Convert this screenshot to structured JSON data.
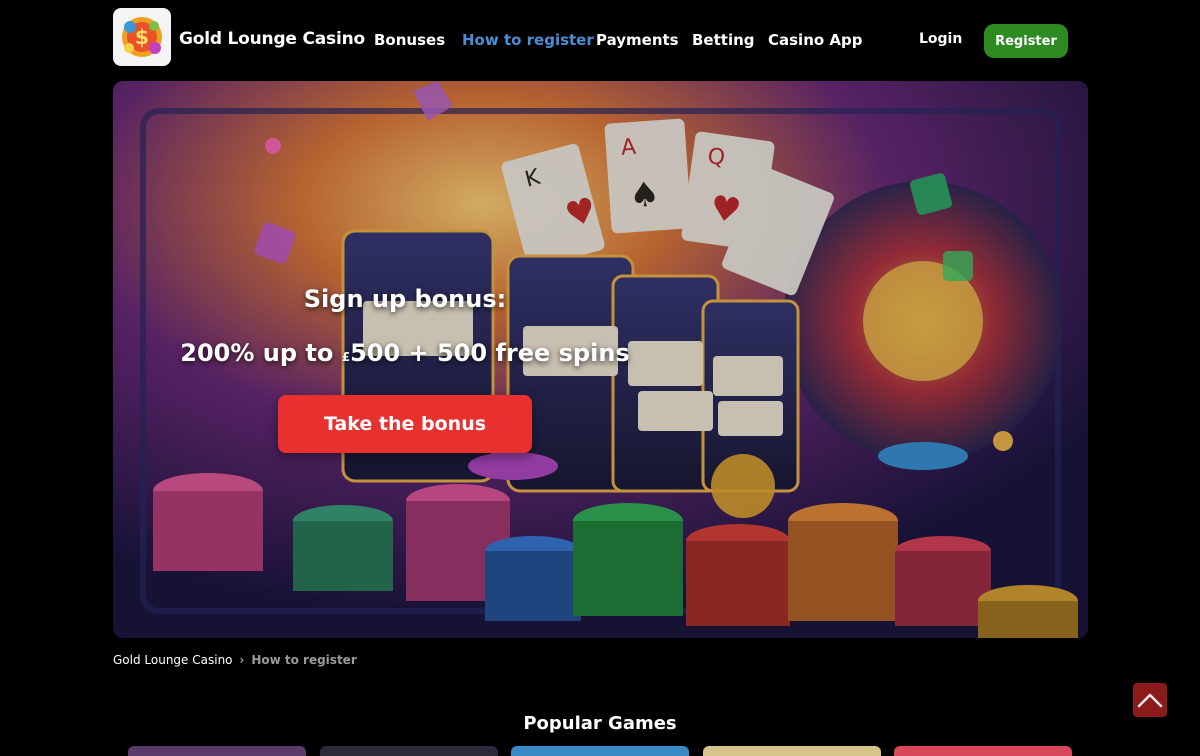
{
  "header": {
    "logo_icon": "casino-slot-logo-icon",
    "brand_name": "Gold Lounge Casino",
    "nav": [
      {
        "label": "Bonuses",
        "active": false
      },
      {
        "label": "How to register",
        "active": true
      },
      {
        "label": "Payments",
        "active": false
      },
      {
        "label": "Betting",
        "active": false
      },
      {
        "label": "Casino App",
        "active": false
      }
    ],
    "login_label": "Login",
    "register_label": "Register"
  },
  "hero": {
    "title": "Sign up bonus:",
    "offer_prefix": "200% up to ",
    "offer_currency": "£",
    "offer_suffix": "500 + 500 free spins",
    "cta_label": "Take the bonus",
    "background_icon": "casino-slots-cards-chips-illustration"
  },
  "breadcrumb": {
    "home": "Gold Lounge Casino",
    "separator": "›",
    "current": "How to register"
  },
  "popular_games": {
    "title": "Popular Games"
  },
  "scroll_top_icon": "chevron-up-icon",
  "colors": {
    "background": "#000000",
    "active_nav": "#4a8fd6",
    "register_button": "#2e8b22",
    "bonus_button": "#e8302f",
    "scroll_top": "#8b1a1a"
  }
}
